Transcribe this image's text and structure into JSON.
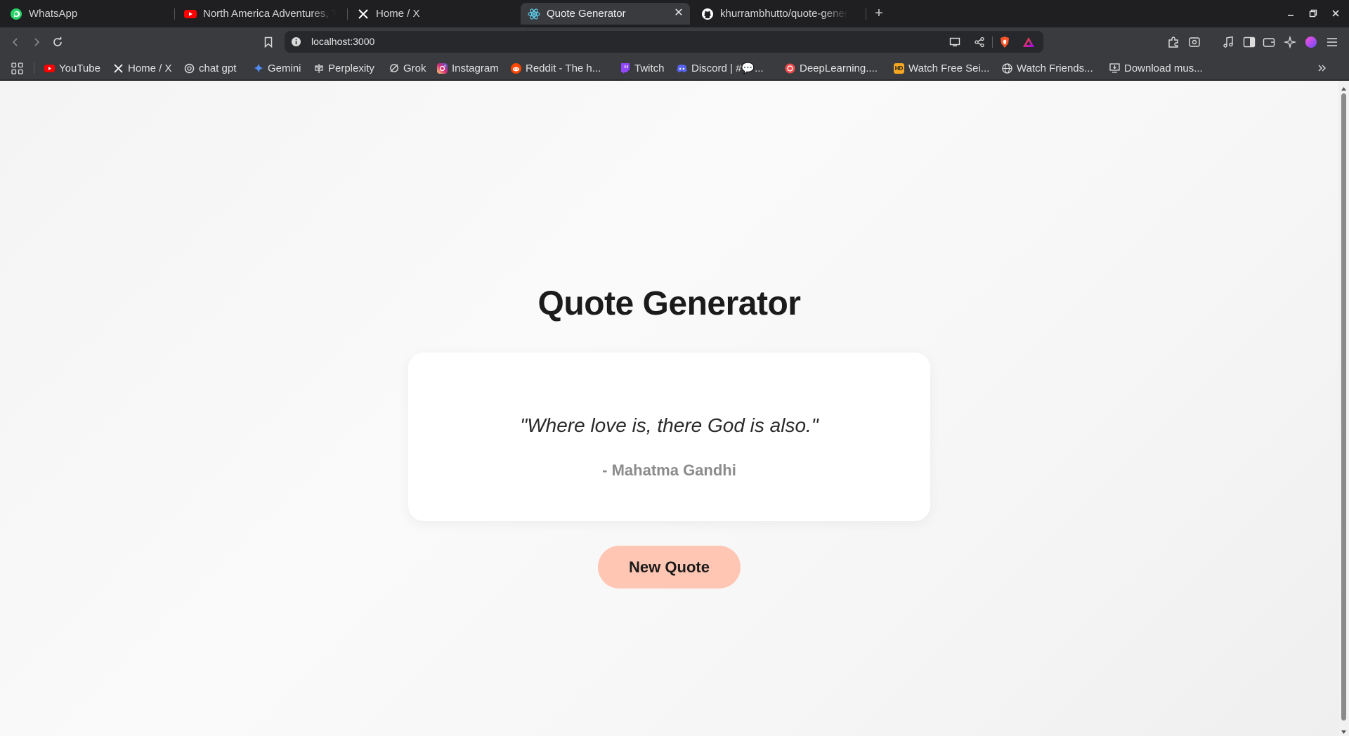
{
  "browser": {
    "tabs": [
      {
        "title": "WhatsApp",
        "icon": "whatsapp-icon",
        "active": false
      },
      {
        "title": "North America Adventures, T",
        "icon": "youtube-icon",
        "active": false
      },
      {
        "title": "Home / X",
        "icon": "x-icon",
        "active": false
      },
      {
        "title": "Quote Generator",
        "icon": "react-icon",
        "active": true
      },
      {
        "title": "khurrambhutto/quote-gener",
        "icon": "github-icon",
        "active": false
      }
    ],
    "address": "localhost:3000",
    "bookmarks": [
      {
        "label": "YouTube",
        "icon": "youtube-icon"
      },
      {
        "label": "Home / X",
        "icon": "x-icon"
      },
      {
        "label": "chat gpt",
        "icon": "openai-icon"
      },
      {
        "label": "Gemini",
        "icon": "gemini-icon"
      },
      {
        "label": "Perplexity",
        "icon": "perplexity-icon"
      },
      {
        "label": "Grok",
        "icon": "grok-icon"
      },
      {
        "label": "Instagram",
        "icon": "instagram-icon"
      },
      {
        "label": "Reddit - The h...",
        "icon": "reddit-icon"
      },
      {
        "label": "Twitch",
        "icon": "twitch-icon"
      },
      {
        "label": "Discord | #💬...",
        "icon": "discord-icon"
      },
      {
        "label": "DeepLearning....",
        "icon": "deeplearning-icon"
      },
      {
        "label": "Watch Free Sei...",
        "icon": "hd-icon"
      },
      {
        "label": "Watch Friends...",
        "icon": "globe-icon"
      },
      {
        "label": "Download mus...",
        "icon": "download-icon"
      }
    ]
  },
  "app": {
    "title": "Quote Generator",
    "quote": "\"Where love is, there God is also.\"",
    "author": "- Mahatma Gandhi",
    "button_label": "New Quote"
  },
  "colors": {
    "button_bg": "#ffc6b3",
    "card_bg": "#ffffff",
    "title": "#1b1b1b",
    "author": "#8b8b8b"
  }
}
